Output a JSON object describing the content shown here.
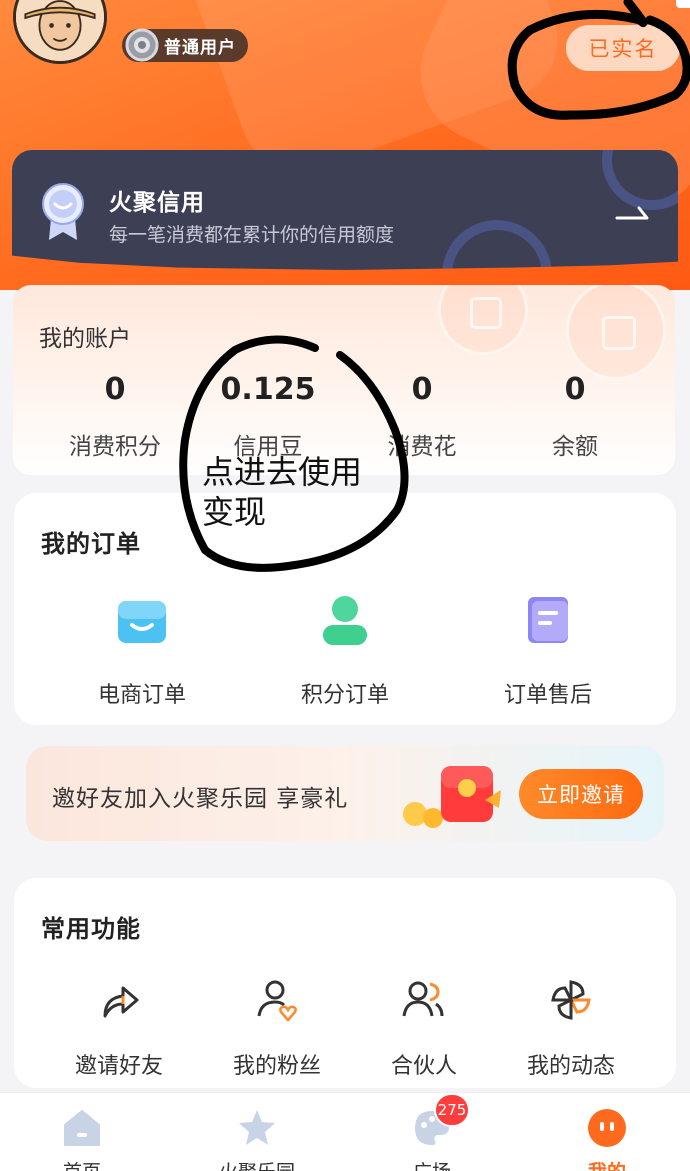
{
  "header": {
    "user_level": "普通用户",
    "verify_status": "已实名"
  },
  "credit": {
    "title": "火聚信用",
    "subtitle": "每一笔消费都在累计你的信用额度"
  },
  "account": {
    "title": "我的账户",
    "stats": [
      {
        "value": "0",
        "label": "消费积分"
      },
      {
        "value": "0.125",
        "label": "信用豆"
      },
      {
        "value": "0",
        "label": "消费花"
      },
      {
        "value": "0",
        "label": "余额"
      }
    ]
  },
  "annotation": {
    "line1": "点进去使用",
    "line2": "变现"
  },
  "orders": {
    "title": "我的订单",
    "items": [
      {
        "label": "电商订单",
        "icon": "shopping-bag-icon"
      },
      {
        "label": "积分订单",
        "icon": "user-icon"
      },
      {
        "label": "订单售后",
        "icon": "document-icon"
      }
    ]
  },
  "invite": {
    "text": "邀好友加入火聚乐园 享豪礼",
    "button": "立即邀请"
  },
  "functions": {
    "title": "常用功能",
    "items": [
      {
        "label": "邀请好友",
        "icon": "share-icon"
      },
      {
        "label": "我的粉丝",
        "icon": "fans-icon"
      },
      {
        "label": "合伙人",
        "icon": "partner-icon"
      },
      {
        "label": "我的动态",
        "icon": "pinwheel-icon"
      }
    ]
  },
  "tabbar": {
    "items": [
      {
        "label": "首页",
        "icon": "home-icon"
      },
      {
        "label": "火聚乐园",
        "icon": "star-icon"
      },
      {
        "label": "广场",
        "icon": "palette-icon"
      },
      {
        "label": "我的",
        "icon": "profile-icon"
      }
    ],
    "square_badge": "275"
  },
  "colors": {
    "brand_orange": "#ff6a1e",
    "credit_bg": "#3d3f55",
    "badge_red": "#ff3d3d"
  }
}
